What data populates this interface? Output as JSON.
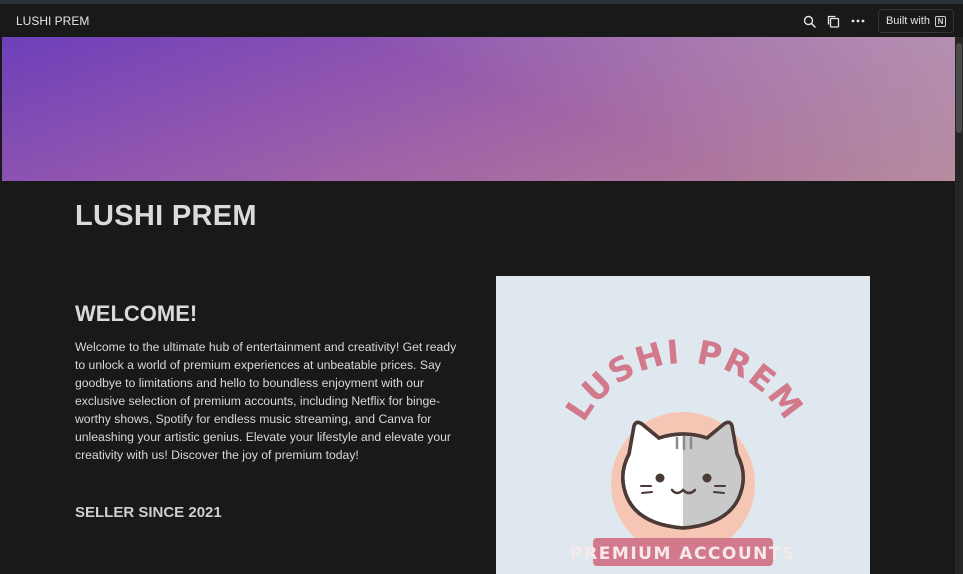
{
  "window": {
    "title": "LUSHI PREM",
    "built_with": "Built with"
  },
  "icons": {
    "search": "search-icon",
    "duplicate": "duplicate-icon",
    "more": "more-icon",
    "notion": "notion-logo-icon"
  },
  "colors": {
    "background": "#191919",
    "cover_start": "#6d3fb9",
    "cover_end": "#b58597",
    "logo_pink": "#d27a8c"
  },
  "page": {
    "title": "LUSHI PREM",
    "heading": "WELCOME!",
    "intro": "Welcome to the ultimate hub of entertainment and creativity! Get ready to unlock a world of premium experiences at unbeatable prices. Say goodbye to limitations and hello to boundless enjoyment with our exclusive selection of premium accounts, including Netflix for binge-worthy shows, Spotify for endless music streaming, and Canva for unleashing your artistic genius. Elevate your lifestyle and elevate your creativity with us! Discover the joy of premium today!",
    "seller": "SELLER SINCE 2021"
  },
  "logo": {
    "arc_text": "LUSHI PREM",
    "banner": "PREMIUM ACCOUNTS"
  }
}
